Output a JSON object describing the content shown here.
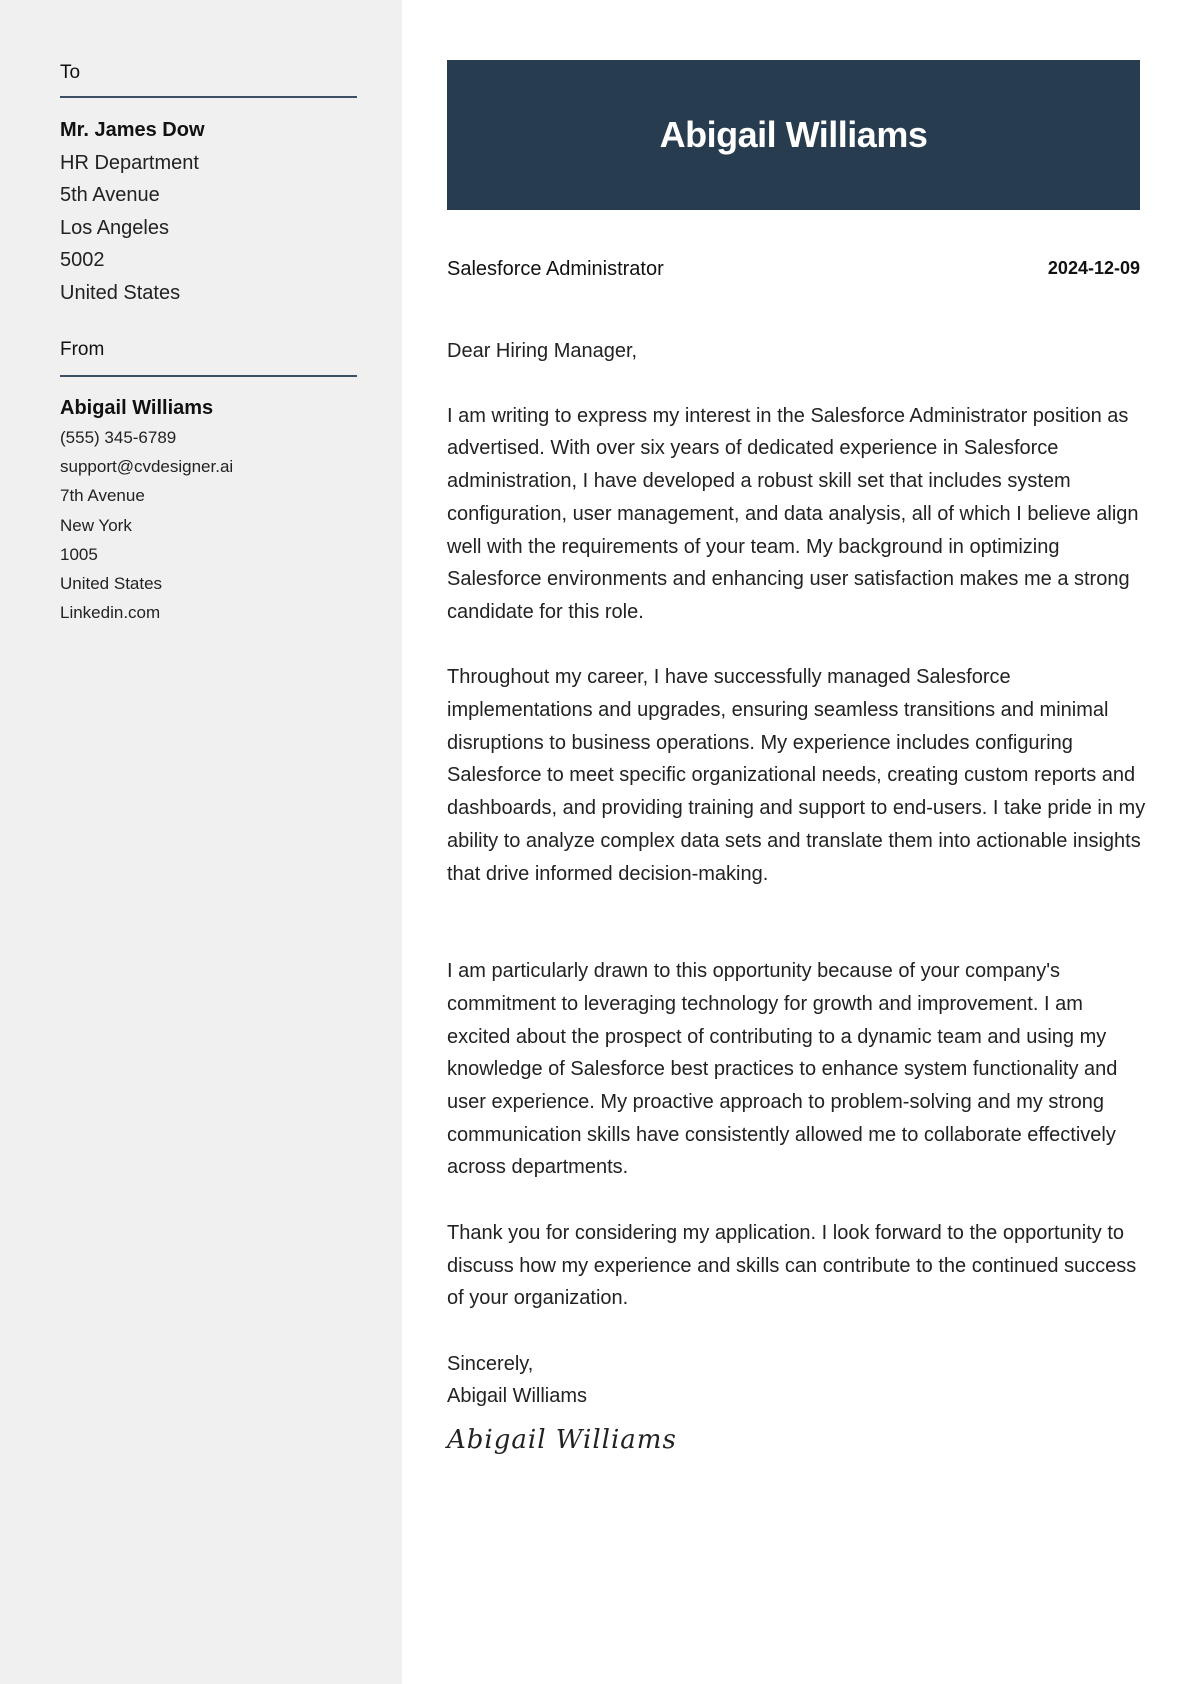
{
  "sidebar": {
    "to": {
      "label": "To",
      "name": "Mr. James Dow",
      "lines": [
        "HR Department",
        "5th Avenue",
        "Los Angeles",
        "5002",
        "United States"
      ]
    },
    "from": {
      "label": "From",
      "name": "Abigail Williams",
      "lines": [
        "(555) 345-6789",
        "support@cvdesigner.ai",
        "7th Avenue",
        "New York",
        "1005",
        "United States",
        "Linkedin.com"
      ]
    }
  },
  "header": {
    "name": "Abigail Williams",
    "background_color": "#283c50"
  },
  "meta": {
    "job_title": "Salesforce Administrator",
    "date": "2024-12-09"
  },
  "letter": {
    "greeting": "Dear Hiring Manager,",
    "paragraphs": [
      "I am writing to express my interest in the Salesforce Administrator position as advertised. With over six years of dedicated experience in Salesforce administration, I have developed a robust skill set that includes system configuration, user management, and data analysis, all of which I believe align well with the requirements of your team. My background in optimizing Salesforce environments and enhancing user satisfaction makes me a strong candidate for this role.",
      "Throughout my career, I have successfully managed Salesforce implementations and upgrades, ensuring seamless transitions and minimal disruptions to business operations. My experience includes configuring Salesforce to meet specific organizational needs, creating custom reports and dashboards, and providing training and support to end-users. I take pride in my ability to analyze complex data sets and translate them into actionable insights that drive informed decision-making.",
      "I am particularly drawn to this opportunity because of your company's commitment to leveraging technology for growth and improvement. I am excited about the prospect of contributing to a dynamic team and using my knowledge of Salesforce best practices to enhance system functionality and user experience. My proactive approach to problem-solving and my strong communication skills have consistently allowed me to collaborate effectively across departments.",
      "Thank you for considering my application. I look forward to the opportunity to discuss how my experience and skills can contribute to the continued success of your organization."
    ],
    "closing": "Sincerely,",
    "signoff_name": "Abigail Williams",
    "signature": "Abigail Williams"
  }
}
